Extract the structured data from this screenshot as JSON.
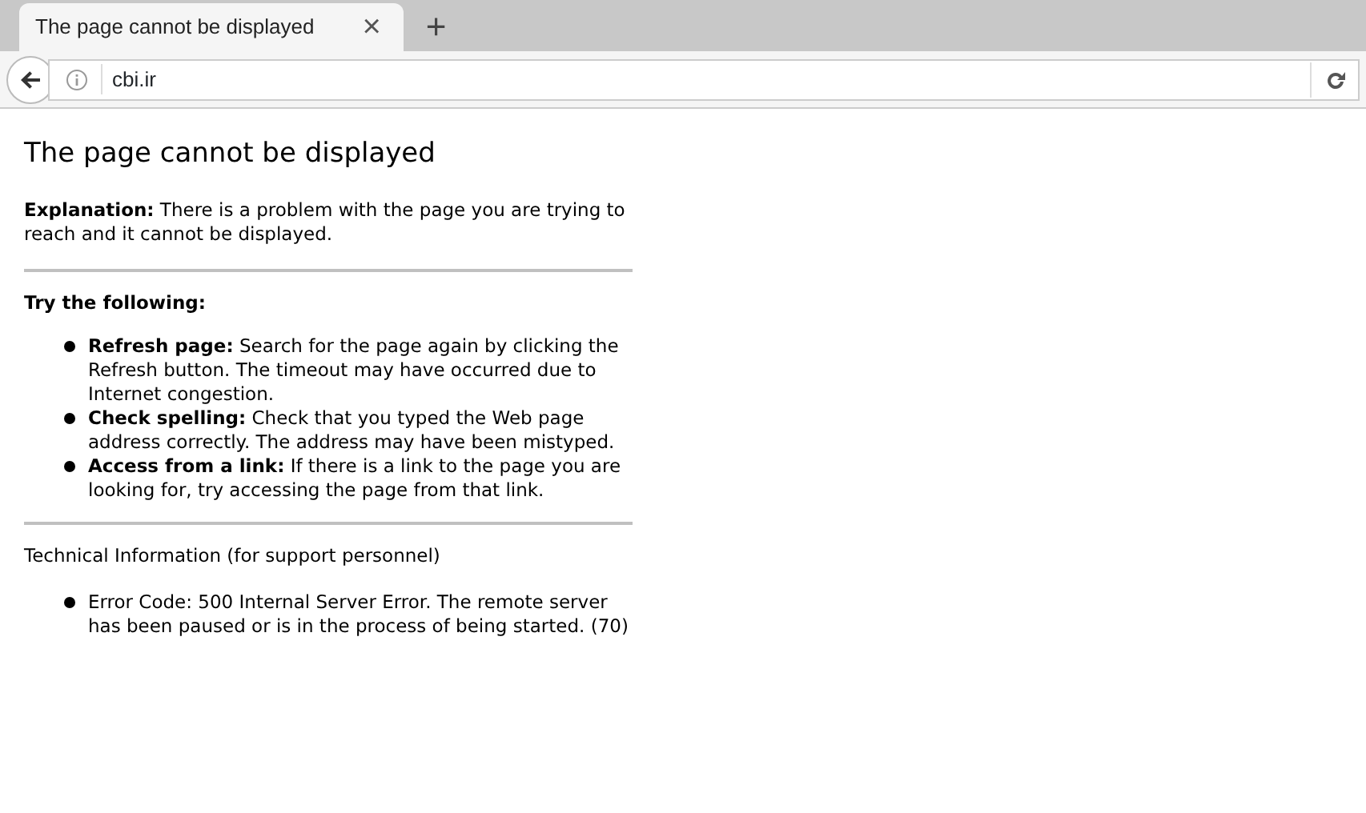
{
  "tabs": [
    {
      "label": "The page cannot be displayed",
      "selected": true,
      "close": "×"
    }
  ],
  "new_tab": "+",
  "address_bar": {
    "url": "cbi.ir"
  },
  "page": {
    "heading": "The page cannot be displayed",
    "explanation": "**Explanation:** There is a problem with the page you are trying to reach and it cannot be displayed.",
    "try_heading": "Try the following:",
    "suggestions": [
      "**Refresh page:** Search for the page again by clicking the Refresh button. The timeout may have occurred due to Internet congestion.",
      "**Check spelling:** Check that you typed the Web page address correctly. The address may have been mistyped.",
      "**Access from a link:** If there is a link to the page you are looking for, try accessing the page from that link."
    ],
    "technical_heading": "Technical Information (for support personnel)",
    "technical_items": [
      "Error Code: 500 Internal Server Error. The remote server has been paused or is in the process of being started. (70)"
    ]
  }
}
